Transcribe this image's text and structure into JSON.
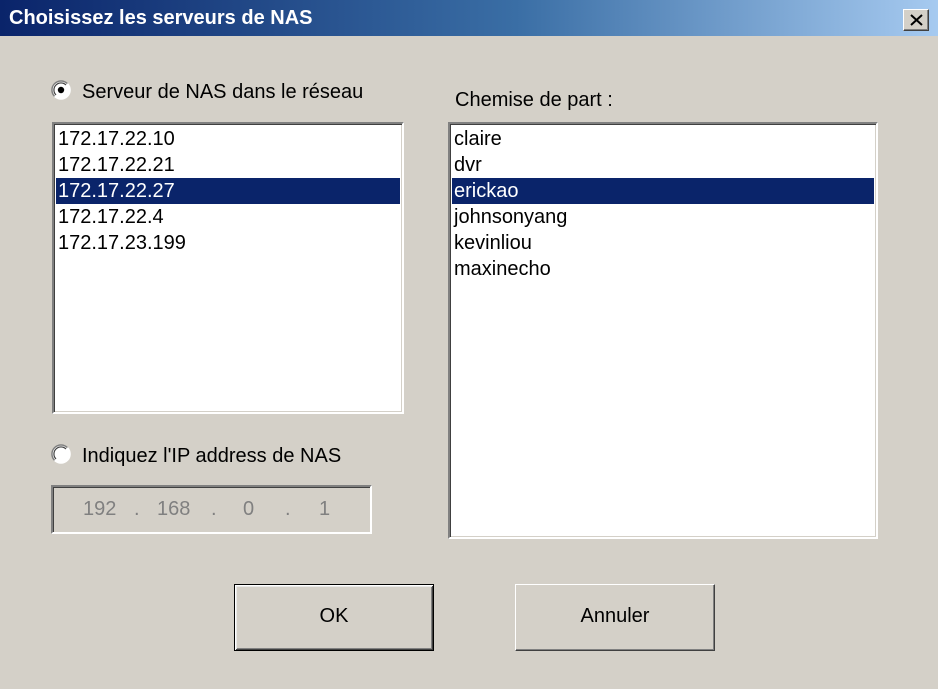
{
  "window": {
    "title": "Choisissez les serveurs de NAS"
  },
  "left_panel": {
    "radio_network_label": "Serveur de NAS dans le réseau",
    "radio_network_checked": true,
    "servers": [
      {
        "label": "172.17.22.10",
        "selected": false
      },
      {
        "label": "172.17.22.21",
        "selected": false
      },
      {
        "label": "172.17.22.27",
        "selected": true
      },
      {
        "label": "172.17.22.4",
        "selected": false
      },
      {
        "label": "172.17.23.199",
        "selected": false
      }
    ],
    "radio_ip_label": "Indiquez l'IP address de NAS",
    "radio_ip_checked": false,
    "ip_address": {
      "octet1": "192",
      "octet2": "168",
      "octet3": "0",
      "octet4": "1",
      "separator": "."
    }
  },
  "right_panel": {
    "label": "Chemise de part :",
    "folders": [
      {
        "label": "claire",
        "selected": false
      },
      {
        "label": "dvr",
        "selected": false
      },
      {
        "label": "erickao",
        "selected": true
      },
      {
        "label": "johnsonyang",
        "selected": false
      },
      {
        "label": "kevinliou",
        "selected": false
      },
      {
        "label": "maxinecho",
        "selected": false
      }
    ]
  },
  "buttons": {
    "ok_label": "OK",
    "cancel_label": "Annuler"
  },
  "icons": {
    "close": "close-icon",
    "radio": "radio-icon"
  },
  "colors": {
    "selection": "#0a246a",
    "dialog_bg": "#d4d0c8"
  }
}
